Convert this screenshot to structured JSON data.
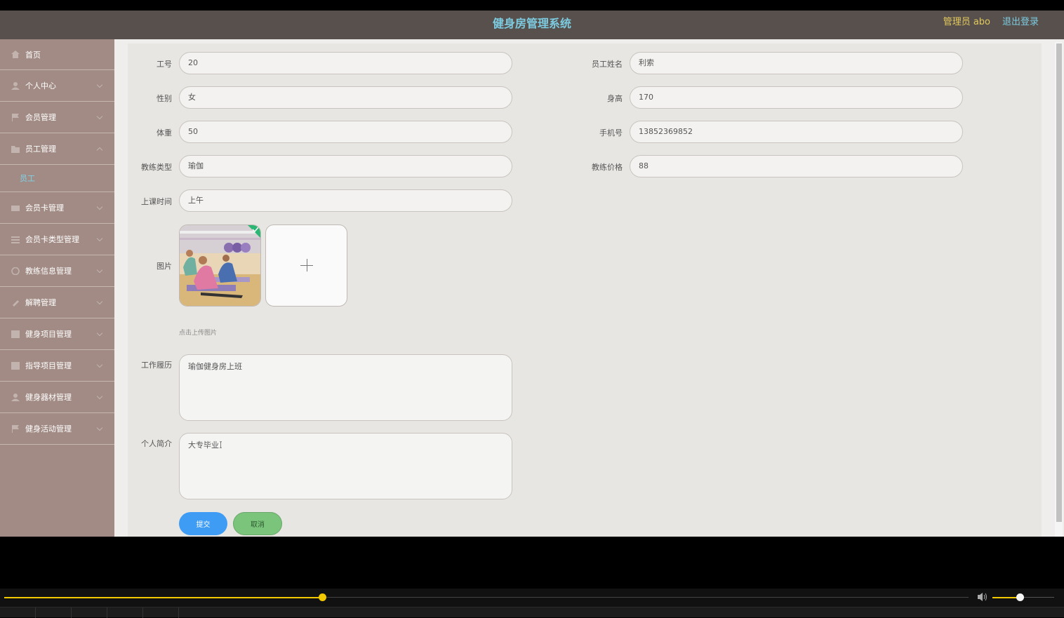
{
  "header": {
    "title": "健身房管理系统",
    "admin_label": "管理员 abo",
    "logout_label": "退出登录"
  },
  "sidebar": {
    "items": [
      {
        "label": "首页",
        "icon": "home-icon"
      },
      {
        "label": "个人中心",
        "icon": "user-icon"
      },
      {
        "label": "会员管理",
        "icon": "flag-icon"
      },
      {
        "label": "员工管理",
        "icon": "folder-icon"
      },
      {
        "label": "会员卡管理",
        "icon": "card-icon"
      },
      {
        "label": "会员卡类型管理",
        "icon": "list-icon"
      },
      {
        "label": "教练信息管理",
        "icon": "clock-icon"
      },
      {
        "label": "解聘管理",
        "icon": "pin-icon"
      },
      {
        "label": "健身项目管理",
        "icon": "grid-icon"
      },
      {
        "label": "指导项目管理",
        "icon": "grid-icon"
      },
      {
        "label": "健身器材管理",
        "icon": "user-icon"
      },
      {
        "label": "健身活动管理",
        "icon": "flag-icon"
      }
    ],
    "active_sub": "员工"
  },
  "form": {
    "employee_no": {
      "label": "工号",
      "value": "20"
    },
    "employee_name": {
      "label": "员工姓名",
      "value": "利索"
    },
    "gender": {
      "label": "性别",
      "value": "女"
    },
    "height": {
      "label": "身高",
      "value": "170"
    },
    "weight": {
      "label": "体重",
      "value": "50"
    },
    "phone": {
      "label": "手机号",
      "value": "13852369852"
    },
    "coach_type": {
      "label": "教练类型",
      "value": "瑜伽"
    },
    "coach_price": {
      "label": "教练价格",
      "value": "88"
    },
    "class_time": {
      "label": "上课时间",
      "value": "上午"
    },
    "image": {
      "label": "图片",
      "hint": "点击上传图片"
    },
    "work_history": {
      "label": "工作履历",
      "value": "瑜伽健身房上班"
    },
    "intro": {
      "label": "个人简介",
      "value": "大专毕业"
    },
    "submit_label": "提交",
    "cancel_label": "取消"
  },
  "player": {
    "progress": 0.33,
    "volume": 0.44
  },
  "colors": {
    "header_bg": "#57504d",
    "title": "#7ccbe0",
    "sidebar_bg": "#a18b84",
    "submit": "#3f9cf5",
    "cancel": "#7bc47c",
    "progress": "#f2c800"
  }
}
